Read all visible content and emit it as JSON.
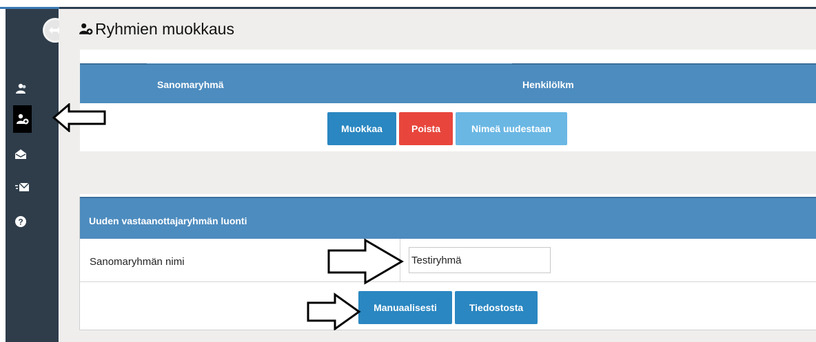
{
  "header": {
    "title": "Ryhmien muokkaus",
    "icon": "user-plus-icon"
  },
  "sidebar": {
    "toggle_icon": "collapse-arrows-icon",
    "items": [
      {
        "name": "users",
        "icon": "users-icon"
      },
      {
        "name": "add-user",
        "icon": "user-plus-icon",
        "active": true
      },
      {
        "name": "messages",
        "icon": "envelope-open-icon"
      },
      {
        "name": "send",
        "icon": "send-mail-icon"
      },
      {
        "name": "help",
        "icon": "help-icon"
      }
    ]
  },
  "groups_table": {
    "columns": [
      "Sanomaryhmä",
      "Henkilölkm"
    ],
    "buttons": {
      "edit": "Muokkaa",
      "delete": "Poista",
      "rename": "Nimeä uudestaan"
    }
  },
  "new_group": {
    "title": "Uuden vastaanottajaryhmän luonti",
    "name_label": "Sanomaryhmän nimi",
    "name_value": "Testiryhmä",
    "buttons": {
      "manual": "Manuaalisesti",
      "from_file": "Tiedostosta"
    }
  },
  "colors": {
    "header_blue": "#4d8cbf",
    "btn_blue": "#2a87c1",
    "btn_red": "#e8463c",
    "btn_light": "#6ab7e4",
    "sidebar": "#2f3d4b"
  }
}
